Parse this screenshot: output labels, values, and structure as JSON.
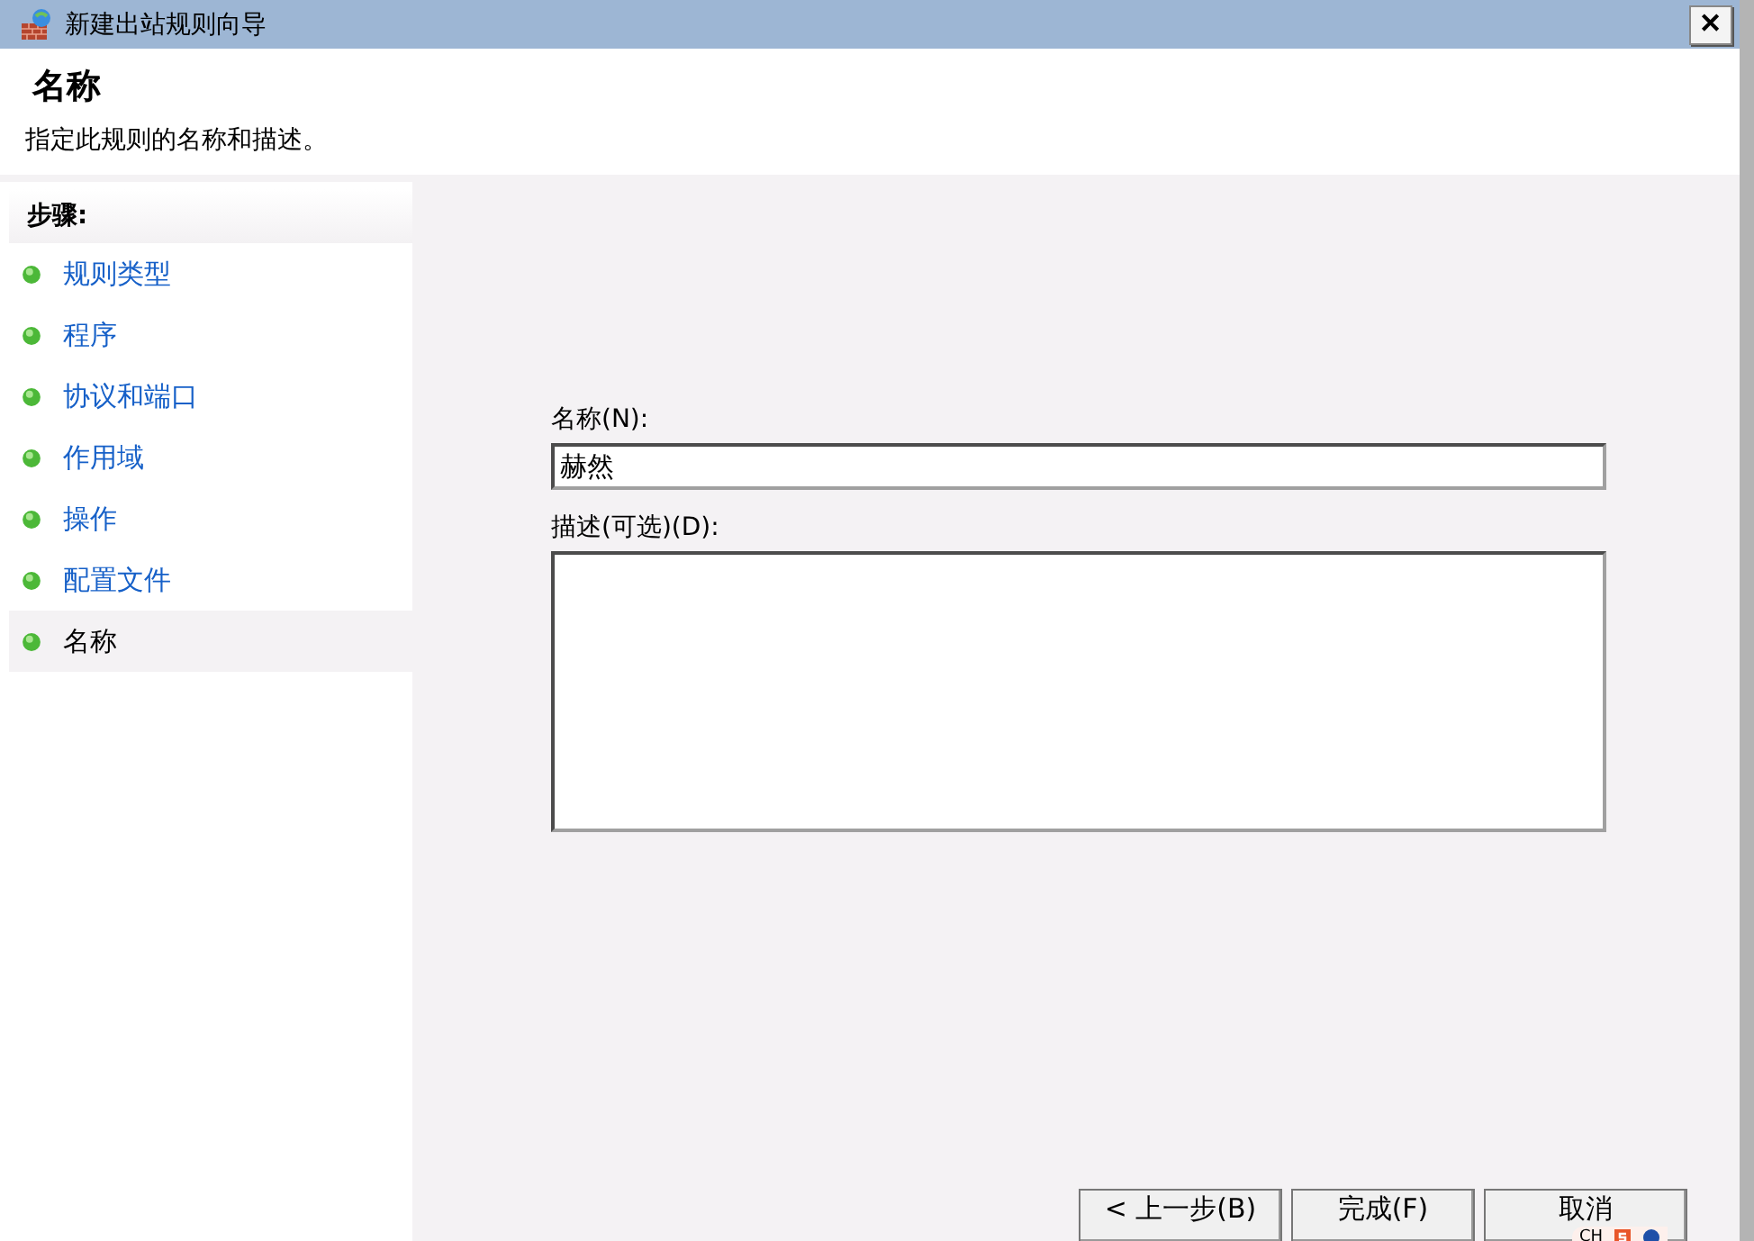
{
  "window": {
    "title": "新建出站规则向导",
    "close_glyph": "✕"
  },
  "header": {
    "title": "名称",
    "subtitle": "指定此规则的名称和描述。"
  },
  "steps": {
    "heading": "步骤:",
    "items": [
      {
        "label": "规则类型",
        "selected": false
      },
      {
        "label": "程序",
        "selected": false
      },
      {
        "label": "协议和端口",
        "selected": false
      },
      {
        "label": "作用域",
        "selected": false
      },
      {
        "label": "操作",
        "selected": false
      },
      {
        "label": "配置文件",
        "selected": false
      },
      {
        "label": "名称",
        "selected": true
      }
    ]
  },
  "form": {
    "name_label": "名称(N):",
    "name_value": "赫然",
    "description_label": "描述(可选)(D):"
  },
  "buttons": [
    {
      "label": "< 上一步(B)"
    },
    {
      "label": "完成(F)"
    },
    {
      "label": "取消"
    }
  ],
  "ime_toolbar": {
    "mode": "CH"
  }
}
